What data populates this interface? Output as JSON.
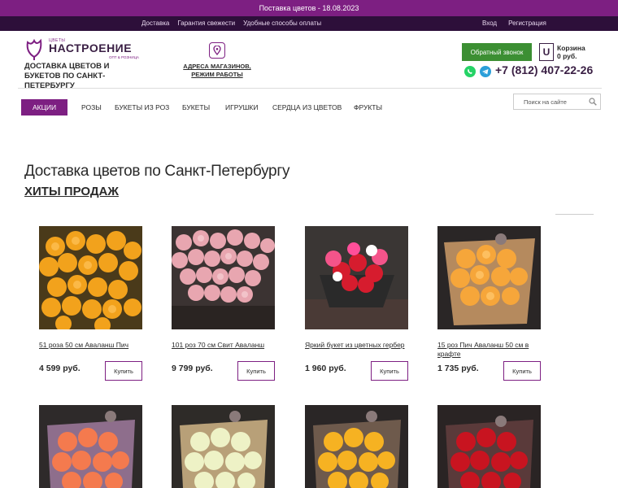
{
  "topbar": {
    "text": "Поставка цветов - 18.08.2023"
  },
  "linkbar": {
    "left": [
      "Доставка",
      "Гарантия свежести",
      "Удобные способы оплаты"
    ],
    "login": "Вход",
    "register": "Регистрация"
  },
  "logo": {
    "small": "ЦВЕТЫ",
    "name": "НАСТРОЕНИЕ",
    "sub": "ОПТ & РОЗНИЦА"
  },
  "tagline": "ДОСТАВКА ЦВЕТОВ И БУКЕТОВ ПО САНКТ-ПЕТЕРБУРГУ",
  "shops": {
    "label": "АДРЕСА МАГАЗИНОВ, РЕЖИМ РАБОТЫ"
  },
  "header": {
    "callback": "Обратный звонок",
    "cart_icon": "U",
    "cart_title": "Корзина",
    "cart_sum": "0 руб.",
    "phone": "+7 (812) 407-22-26"
  },
  "nav": {
    "items": [
      "АКЦИИ",
      "РОЗЫ",
      "БУКЕТЫ ИЗ РОЗ",
      "БУКЕТЫ",
      "ИГРУШКИ",
      "СЕРДЦА ИЗ ЦВЕТОВ",
      "ФРУКТЫ"
    ]
  },
  "search": {
    "placeholder": "Поиск на сайте"
  },
  "page": {
    "title": "Доставка цветов по Санкт-Петербургу",
    "hits": "ХИТЫ ПРОДАЖ"
  },
  "products": [
    {
      "name": "51 роза 50 см Аваланш Пич",
      "price": "4 599 руб.",
      "buy": "Купить"
    },
    {
      "name": "101 роз 70 см Свит Аваланш",
      "price": "9 799 руб.",
      "buy": "Купить"
    },
    {
      "name": "Яркий букет из цветных гербер",
      "price": "1 960 руб.",
      "buy": "Купить"
    },
    {
      "name": "15 роз Пич Аваланш 50 см в крафте",
      "price": "1 735 руб.",
      "buy": "Купить"
    }
  ],
  "colors": {
    "accent": "#7d1f82",
    "topbar": "#7d1f82",
    "linkbar": "#2d0f3a",
    "callback": "#3c8f33"
  },
  "icons": {
    "location": "map-pin-icon",
    "whatsapp": "whatsapp-icon",
    "telegram": "telegram-icon",
    "search": "search-icon",
    "cart": "cart-icon"
  }
}
